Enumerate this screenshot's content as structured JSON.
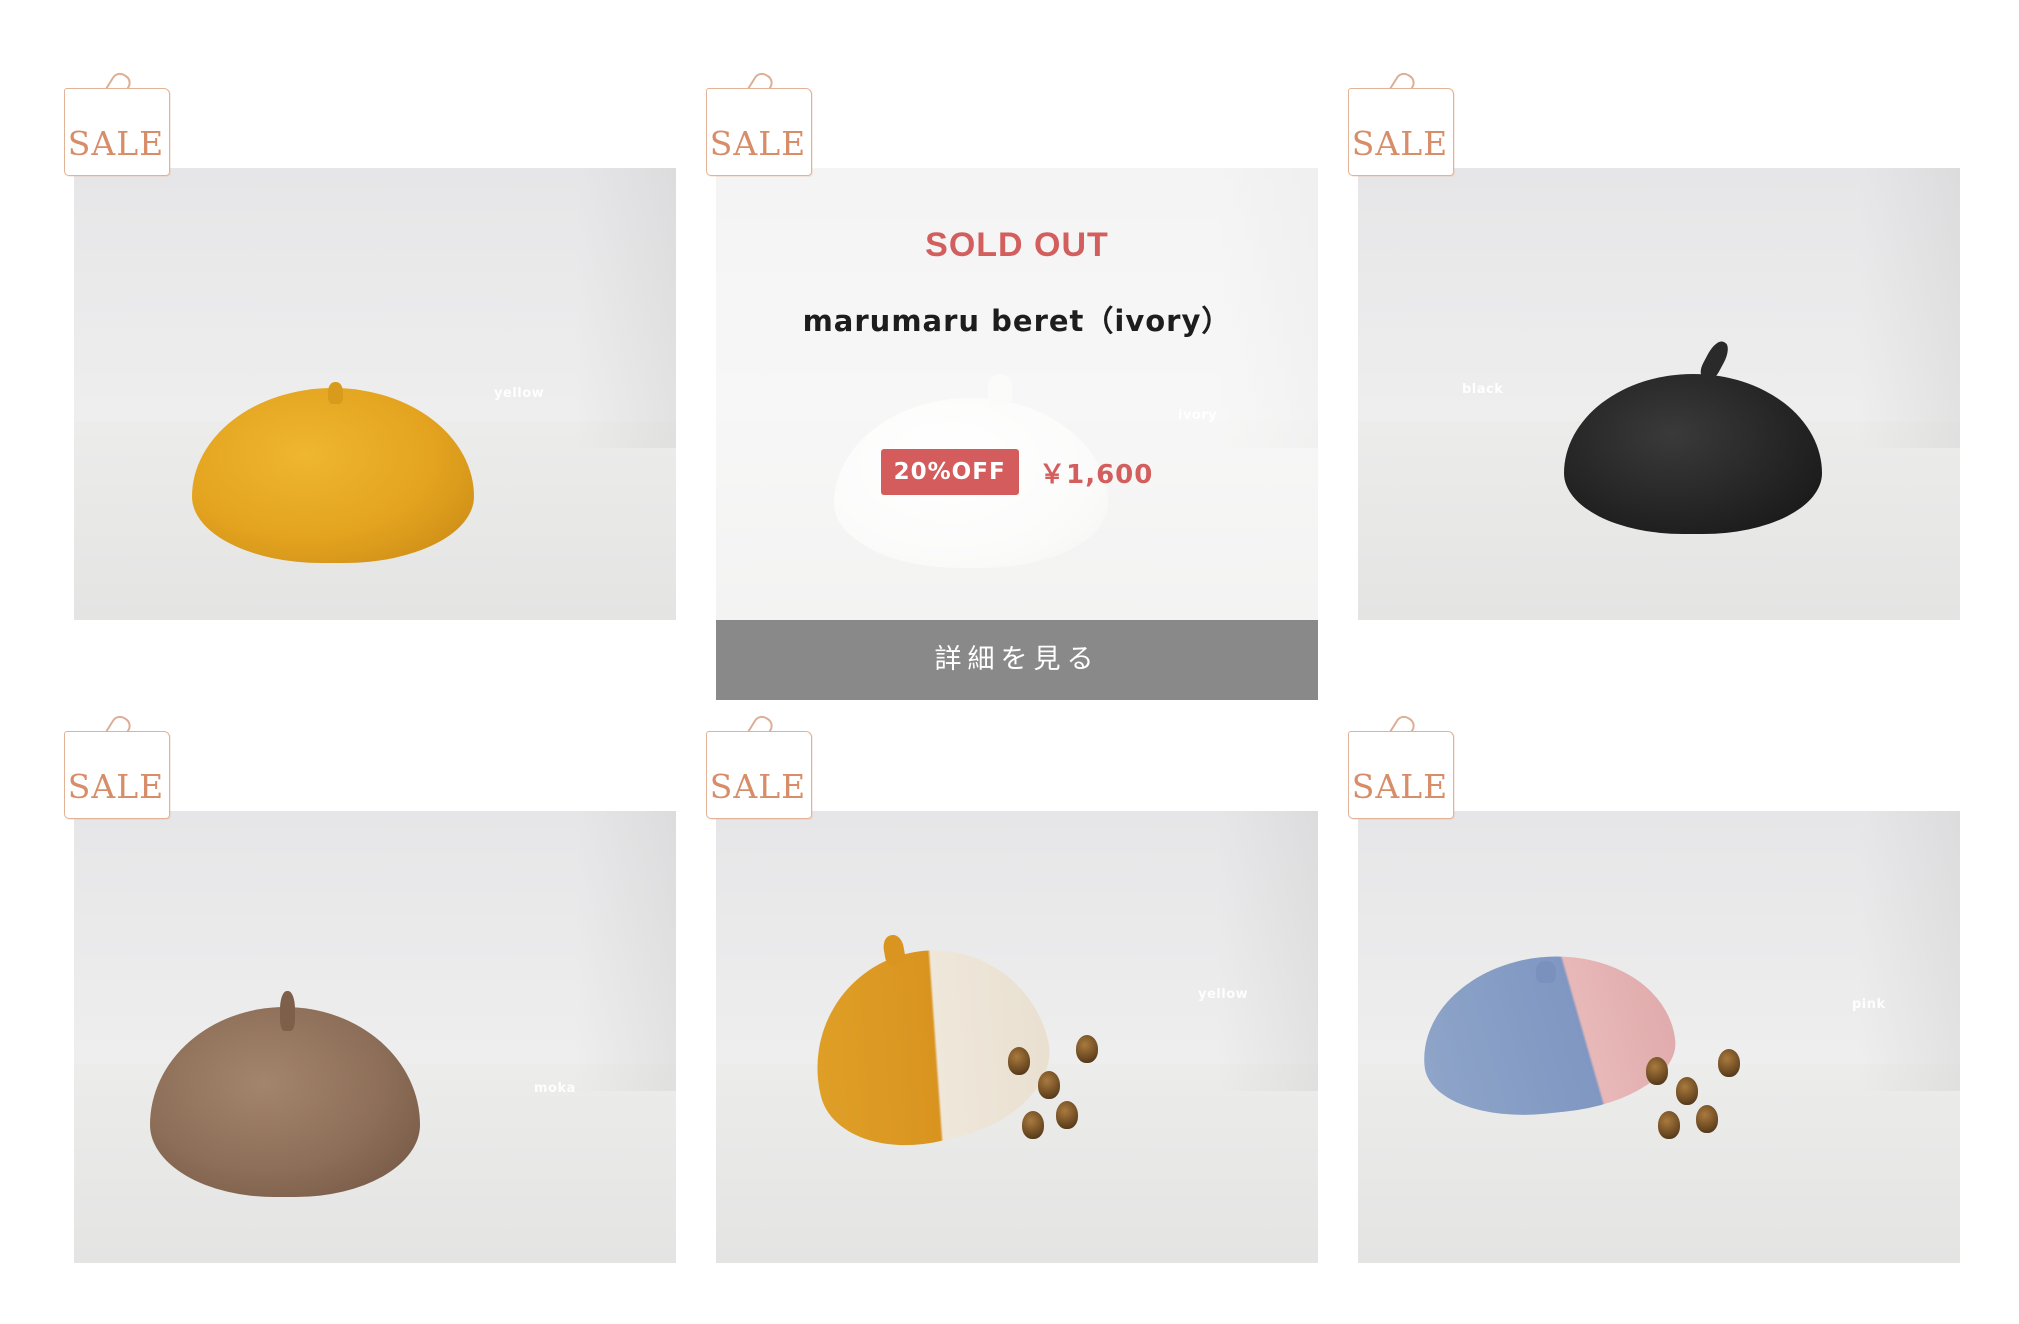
{
  "products": [
    {
      "sale_label": "SALE",
      "caption": "yellow"
    },
    {
      "sale_label": "SALE",
      "caption": "ivory",
      "overlay": {
        "status": "SOLD OUT",
        "name": "marumaru beret（ivory）",
        "discount": "20%OFF",
        "price": "￥1,600",
        "detail_button": "詳細を見る"
      }
    },
    {
      "sale_label": "SALE",
      "caption": "black"
    },
    {
      "sale_label": "SALE",
      "caption": "moka"
    },
    {
      "sale_label": "SALE",
      "caption": "yellow"
    },
    {
      "sale_label": "SALE",
      "caption": "pink"
    }
  ],
  "colors": {
    "sale_tag": "#d88d69",
    "sold_out": "#d35e5e",
    "badge": "#d45c5c",
    "detail_button": "#898989"
  }
}
